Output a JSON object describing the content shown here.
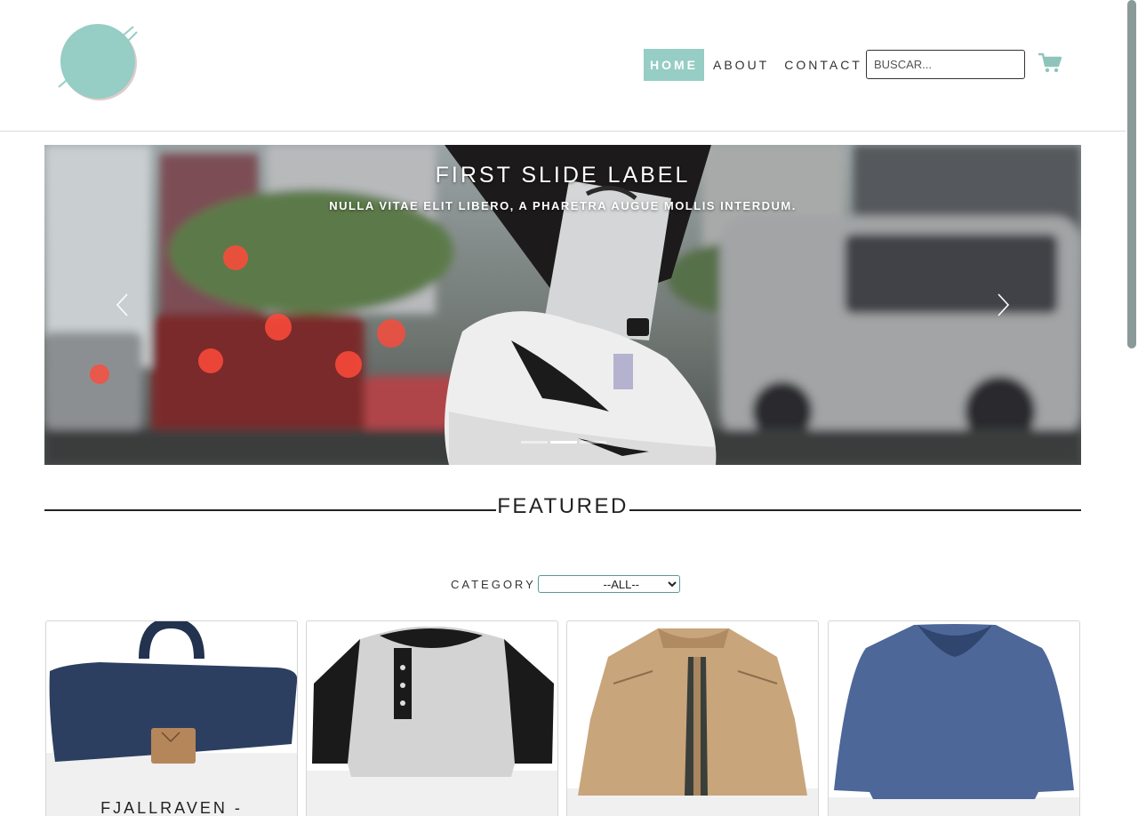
{
  "header": {
    "logo_icon": "circle-logo",
    "nav": [
      {
        "label": "HOME",
        "active": true
      },
      {
        "label": "ABOUT",
        "active": false
      },
      {
        "label": "CONTACT",
        "active": false
      }
    ],
    "search_placeholder": "BUSCAR...",
    "cart_icon": "shopping-cart-icon"
  },
  "carousel": {
    "title": "FIRST SLIDE LABEL",
    "subtitle": "NULLA VITAE ELIT LIBERO, A PHARETRA AUGUE MOLLIS INTERDUM.",
    "slides_count": 3,
    "active_slide": 1
  },
  "featured": {
    "title": "FEATURED"
  },
  "filter": {
    "label": "CATEGORY",
    "selected": "--ALL--"
  },
  "products": [
    {
      "name": "FJALLRAVEN - FOLDSACK",
      "image": "navy-backpack"
    },
    {
      "name": "",
      "image": "raglan-henley-shirt"
    },
    {
      "name": "",
      "image": "khaki-jacket"
    },
    {
      "name": "",
      "image": "blue-long-sleeve-tee"
    }
  ],
  "colors": {
    "accent": "#96cdc5",
    "text": "#222222"
  }
}
